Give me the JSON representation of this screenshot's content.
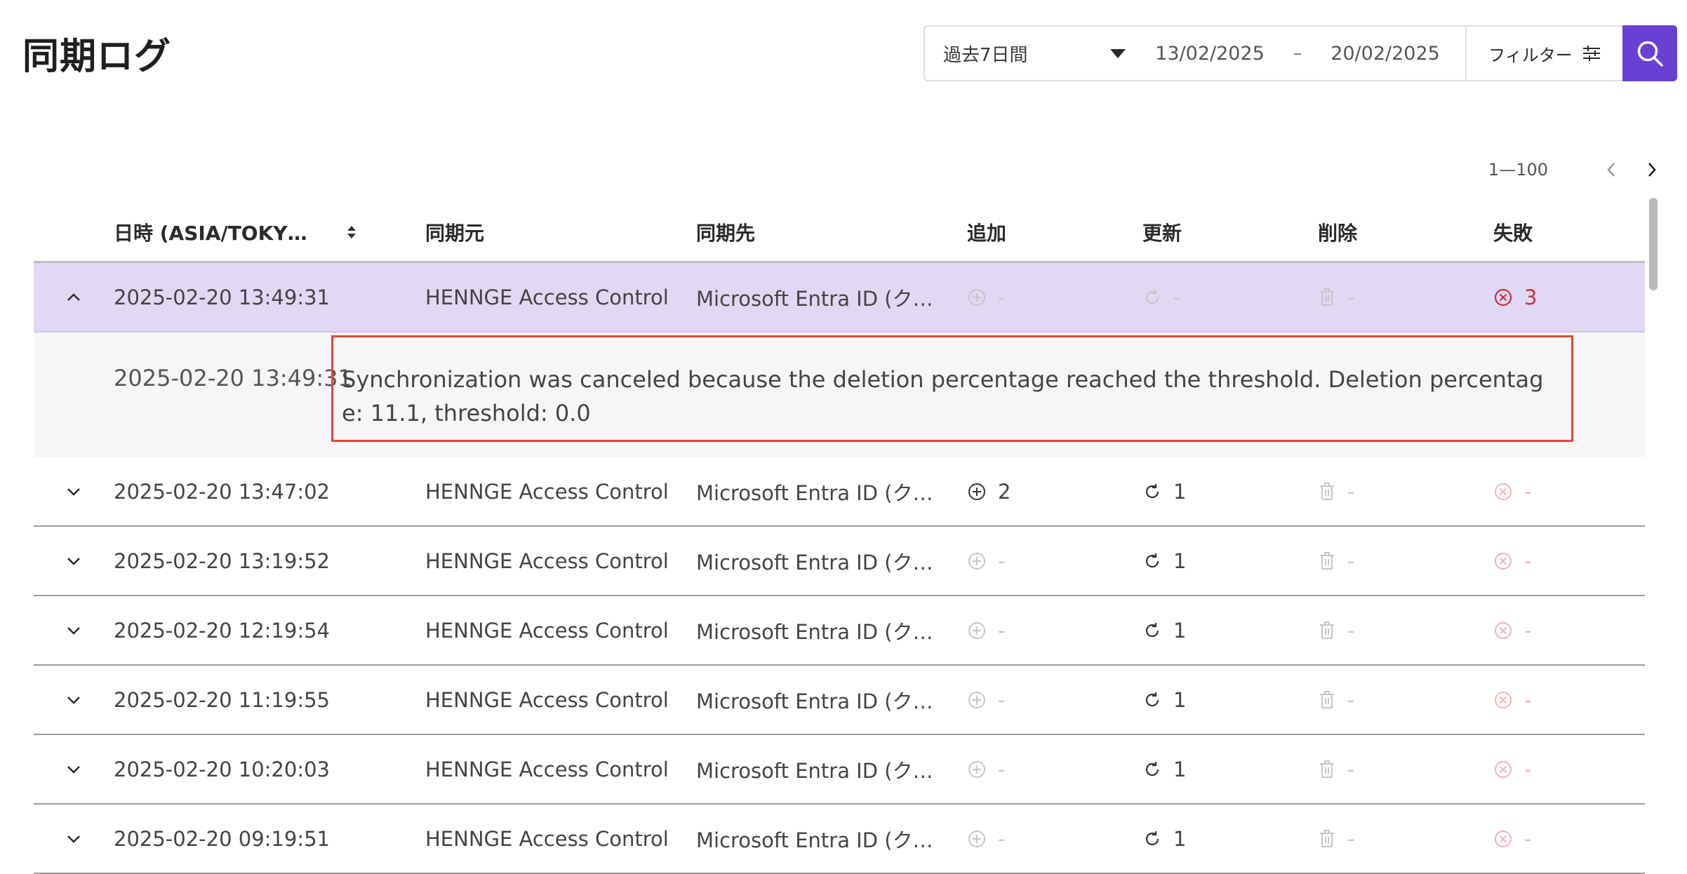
{
  "header": {
    "title": "同期ログ"
  },
  "filter_bar": {
    "period_label": "過去7日間",
    "date_from": "13/02/2025",
    "date_separator": "–",
    "date_to": "20/02/2025",
    "filter_label": "フィルター"
  },
  "pagination": {
    "range": "1—100"
  },
  "table": {
    "columns": {
      "datetime": "日時 (ASIA/TOKY…",
      "source": "同期元",
      "destination": "同期先",
      "added": "追加",
      "updated": "更新",
      "deleted": "削除",
      "failed": "失敗"
    },
    "expanded_row": {
      "datetime": "2025-02-20 13:49:31",
      "source": "HENNGE Access Control",
      "destination": "Microsoft Entra ID (ク…",
      "added": "-",
      "updated": "-",
      "deleted": "-",
      "failed": "3",
      "detail": {
        "datetime": "2025-02-20 13:49:31",
        "message": "Synchronization was canceled because the deletion percentage reached the threshold. Deletion percentage: 11.1, threshold: 0.0"
      }
    },
    "rows": [
      {
        "datetime": "2025-02-20 13:47:02",
        "source": "HENNGE Access Control",
        "destination": "Microsoft Entra ID (ク…",
        "added": "2",
        "updated": "1",
        "deleted": "-",
        "failed": "-"
      },
      {
        "datetime": "2025-02-20 13:19:52",
        "source": "HENNGE Access Control",
        "destination": "Microsoft Entra ID (ク…",
        "added": "-",
        "updated": "1",
        "deleted": "-",
        "failed": "-"
      },
      {
        "datetime": "2025-02-20 12:19:54",
        "source": "HENNGE Access Control",
        "destination": "Microsoft Entra ID (ク…",
        "added": "-",
        "updated": "1",
        "deleted": "-",
        "failed": "-"
      },
      {
        "datetime": "2025-02-20 11:19:55",
        "source": "HENNGE Access Control",
        "destination": "Microsoft Entra ID (ク…",
        "added": "-",
        "updated": "1",
        "deleted": "-",
        "failed": "-"
      },
      {
        "datetime": "2025-02-20 10:20:03",
        "source": "HENNGE Access Control",
        "destination": "Microsoft Entra ID (ク…",
        "added": "-",
        "updated": "1",
        "deleted": "-",
        "failed": "-"
      },
      {
        "datetime": "2025-02-20 09:19:51",
        "source": "HENNGE Access Control",
        "destination": "Microsoft Entra ID (ク…",
        "added": "-",
        "updated": "1",
        "deleted": "-",
        "failed": "-"
      }
    ]
  },
  "theme": {
    "accent": "#6a3fd3",
    "expanded_bg": "#e1d8f4",
    "error": "#c8323f",
    "highlight_border": "#e2483a"
  },
  "icons": [
    "chevron-up-icon",
    "chevron-down-icon",
    "sort-icon",
    "plus-circle-icon",
    "refresh-icon",
    "trash-icon",
    "x-circle-icon",
    "filter-sliders-icon",
    "search-icon",
    "chevron-left-icon",
    "chevron-right-icon"
  ]
}
